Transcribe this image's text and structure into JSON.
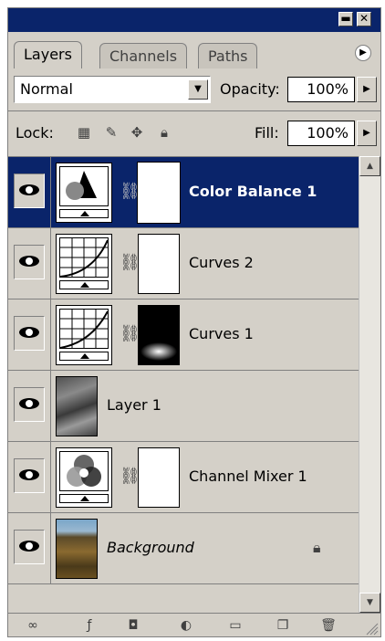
{
  "panel": {
    "tabs": [
      {
        "label": "Layers",
        "active": true
      },
      {
        "label": "Channels",
        "active": false
      },
      {
        "label": "Paths",
        "active": false
      }
    ],
    "blend_mode": "Normal",
    "opacity_label": "Opacity:",
    "opacity_value": "100%",
    "lock_label": "Lock:",
    "fill_label": "Fill:",
    "fill_value": "100%"
  },
  "layers": [
    {
      "name": "Color Balance 1",
      "type": "color-balance-adjustment",
      "selected": true,
      "mask": "white"
    },
    {
      "name": "Curves 2",
      "type": "curves-adjustment",
      "selected": false,
      "mask": "white"
    },
    {
      "name": "Curves 1",
      "type": "curves-adjustment",
      "selected": false,
      "mask": "black-with-light-spot"
    },
    {
      "name": "Layer 1",
      "type": "pixel-layer",
      "selected": false
    },
    {
      "name": "Channel Mixer 1",
      "type": "channel-mixer-adjustment",
      "selected": false,
      "mask": "white"
    },
    {
      "name": "Background",
      "type": "background",
      "selected": false,
      "locked": true
    }
  ],
  "colors": {
    "selection": "#0a246a",
    "panel_bg": "#d4d0c8"
  },
  "icons": {
    "bottom": [
      "link-layers-icon",
      "layer-style-icon",
      "add-mask-icon",
      "new-fill-adjustment-icon",
      "new-group-icon",
      "new-layer-icon",
      "delete-layer-icon"
    ]
  }
}
